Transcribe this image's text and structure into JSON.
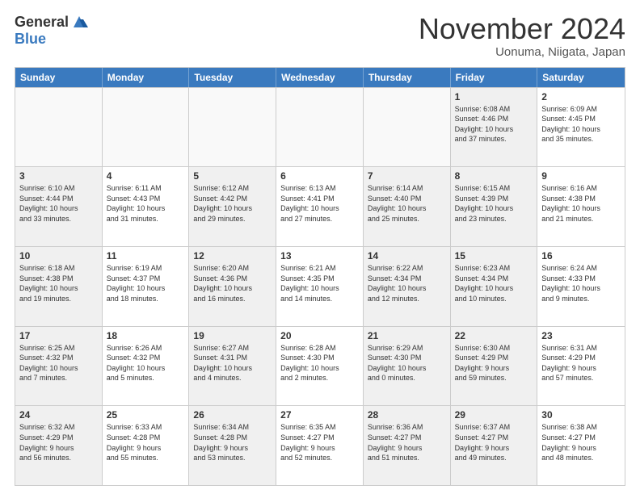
{
  "header": {
    "logo_general": "General",
    "logo_blue": "Blue",
    "month_title": "November 2024",
    "location": "Uonuma, Niigata, Japan"
  },
  "weekdays": [
    "Sunday",
    "Monday",
    "Tuesday",
    "Wednesday",
    "Thursday",
    "Friday",
    "Saturday"
  ],
  "rows": [
    [
      {
        "day": "",
        "info": "",
        "empty": true
      },
      {
        "day": "",
        "info": "",
        "empty": true
      },
      {
        "day": "",
        "info": "",
        "empty": true
      },
      {
        "day": "",
        "info": "",
        "empty": true
      },
      {
        "day": "",
        "info": "",
        "empty": true
      },
      {
        "day": "1",
        "info": "Sunrise: 6:08 AM\nSunset: 4:46 PM\nDaylight: 10 hours\nand 37 minutes.",
        "shaded": true
      },
      {
        "day": "2",
        "info": "Sunrise: 6:09 AM\nSunset: 4:45 PM\nDaylight: 10 hours\nand 35 minutes."
      }
    ],
    [
      {
        "day": "3",
        "info": "Sunrise: 6:10 AM\nSunset: 4:44 PM\nDaylight: 10 hours\nand 33 minutes.",
        "shaded": true
      },
      {
        "day": "4",
        "info": "Sunrise: 6:11 AM\nSunset: 4:43 PM\nDaylight: 10 hours\nand 31 minutes."
      },
      {
        "day": "5",
        "info": "Sunrise: 6:12 AM\nSunset: 4:42 PM\nDaylight: 10 hours\nand 29 minutes.",
        "shaded": true
      },
      {
        "day": "6",
        "info": "Sunrise: 6:13 AM\nSunset: 4:41 PM\nDaylight: 10 hours\nand 27 minutes."
      },
      {
        "day": "7",
        "info": "Sunrise: 6:14 AM\nSunset: 4:40 PM\nDaylight: 10 hours\nand 25 minutes.",
        "shaded": true
      },
      {
        "day": "8",
        "info": "Sunrise: 6:15 AM\nSunset: 4:39 PM\nDaylight: 10 hours\nand 23 minutes.",
        "shaded": true
      },
      {
        "day": "9",
        "info": "Sunrise: 6:16 AM\nSunset: 4:38 PM\nDaylight: 10 hours\nand 21 minutes."
      }
    ],
    [
      {
        "day": "10",
        "info": "Sunrise: 6:18 AM\nSunset: 4:38 PM\nDaylight: 10 hours\nand 19 minutes.",
        "shaded": true
      },
      {
        "day": "11",
        "info": "Sunrise: 6:19 AM\nSunset: 4:37 PM\nDaylight: 10 hours\nand 18 minutes."
      },
      {
        "day": "12",
        "info": "Sunrise: 6:20 AM\nSunset: 4:36 PM\nDaylight: 10 hours\nand 16 minutes.",
        "shaded": true
      },
      {
        "day": "13",
        "info": "Sunrise: 6:21 AM\nSunset: 4:35 PM\nDaylight: 10 hours\nand 14 minutes."
      },
      {
        "day": "14",
        "info": "Sunrise: 6:22 AM\nSunset: 4:34 PM\nDaylight: 10 hours\nand 12 minutes.",
        "shaded": true
      },
      {
        "day": "15",
        "info": "Sunrise: 6:23 AM\nSunset: 4:34 PM\nDaylight: 10 hours\nand 10 minutes.",
        "shaded": true
      },
      {
        "day": "16",
        "info": "Sunrise: 6:24 AM\nSunset: 4:33 PM\nDaylight: 10 hours\nand 9 minutes."
      }
    ],
    [
      {
        "day": "17",
        "info": "Sunrise: 6:25 AM\nSunset: 4:32 PM\nDaylight: 10 hours\nand 7 minutes.",
        "shaded": true
      },
      {
        "day": "18",
        "info": "Sunrise: 6:26 AM\nSunset: 4:32 PM\nDaylight: 10 hours\nand 5 minutes."
      },
      {
        "day": "19",
        "info": "Sunrise: 6:27 AM\nSunset: 4:31 PM\nDaylight: 10 hours\nand 4 minutes.",
        "shaded": true
      },
      {
        "day": "20",
        "info": "Sunrise: 6:28 AM\nSunset: 4:30 PM\nDaylight: 10 hours\nand 2 minutes."
      },
      {
        "day": "21",
        "info": "Sunrise: 6:29 AM\nSunset: 4:30 PM\nDaylight: 10 hours\nand 0 minutes.",
        "shaded": true
      },
      {
        "day": "22",
        "info": "Sunrise: 6:30 AM\nSunset: 4:29 PM\nDaylight: 9 hours\nand 59 minutes.",
        "shaded": true
      },
      {
        "day": "23",
        "info": "Sunrise: 6:31 AM\nSunset: 4:29 PM\nDaylight: 9 hours\nand 57 minutes."
      }
    ],
    [
      {
        "day": "24",
        "info": "Sunrise: 6:32 AM\nSunset: 4:29 PM\nDaylight: 9 hours\nand 56 minutes.",
        "shaded": true
      },
      {
        "day": "25",
        "info": "Sunrise: 6:33 AM\nSunset: 4:28 PM\nDaylight: 9 hours\nand 55 minutes."
      },
      {
        "day": "26",
        "info": "Sunrise: 6:34 AM\nSunset: 4:28 PM\nDaylight: 9 hours\nand 53 minutes.",
        "shaded": true
      },
      {
        "day": "27",
        "info": "Sunrise: 6:35 AM\nSunset: 4:27 PM\nDaylight: 9 hours\nand 52 minutes."
      },
      {
        "day": "28",
        "info": "Sunrise: 6:36 AM\nSunset: 4:27 PM\nDaylight: 9 hours\nand 51 minutes.",
        "shaded": true
      },
      {
        "day": "29",
        "info": "Sunrise: 6:37 AM\nSunset: 4:27 PM\nDaylight: 9 hours\nand 49 minutes.",
        "shaded": true
      },
      {
        "day": "30",
        "info": "Sunrise: 6:38 AM\nSunset: 4:27 PM\nDaylight: 9 hours\nand 48 minutes."
      }
    ]
  ]
}
